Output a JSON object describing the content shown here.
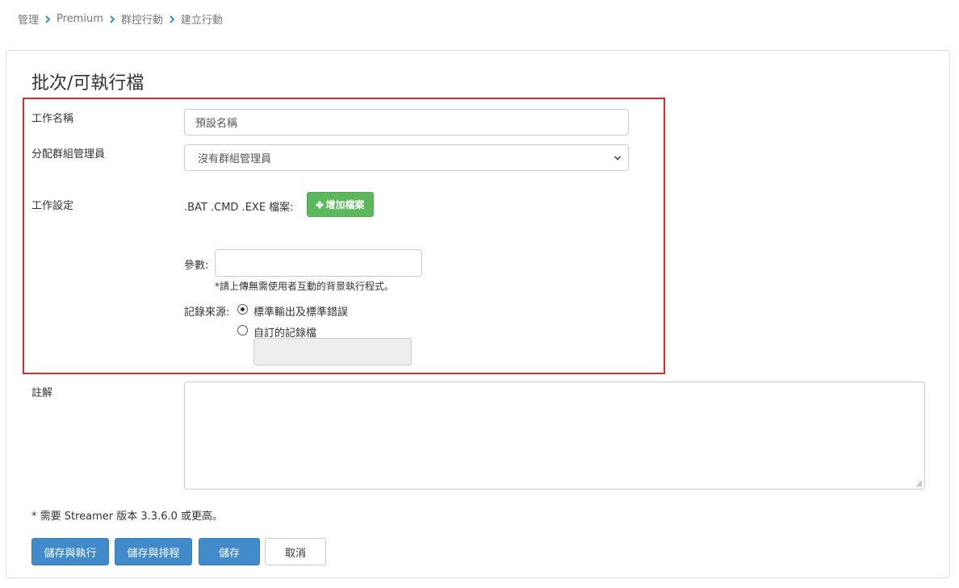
{
  "breadcrumb": {
    "items": [
      "管理",
      "Premium",
      "群控行動",
      "建立行動"
    ]
  },
  "panel": {
    "title": "批次/可執行檔"
  },
  "form": {
    "job_name_label": "工作名稱",
    "job_name_value": "預設名稱",
    "group_admin_label": "分配群組管理員",
    "group_admin_selected": "沒有群組管理員",
    "job_settings_label": "工作設定",
    "file_types_label": ".BAT .CMD .EXE 檔案:",
    "add_file_button": "增加檔案",
    "params_label": "參數:",
    "params_value": "",
    "upload_hint": "*請上傳無需使用者互動的背景執行程式。",
    "log_source_label": "記錄來源:",
    "log_options": [
      {
        "label": "標準輸出及標準錯誤",
        "checked": true
      },
      {
        "label": "自訂的記錄檔",
        "checked": false
      }
    ],
    "custom_log_value": "",
    "notes_label": "註解",
    "notes_value": ""
  },
  "footnote": "* 需要 Streamer 版本 3.3.6.0 或更高。",
  "buttons": {
    "save_and_run": "儲存與執行",
    "save_and_schedule": "儲存與排程",
    "save": "儲存",
    "cancel": "取消"
  },
  "colors": {
    "primary": "#428bca",
    "success": "#5cb85c",
    "highlight": "#e02a2a"
  }
}
